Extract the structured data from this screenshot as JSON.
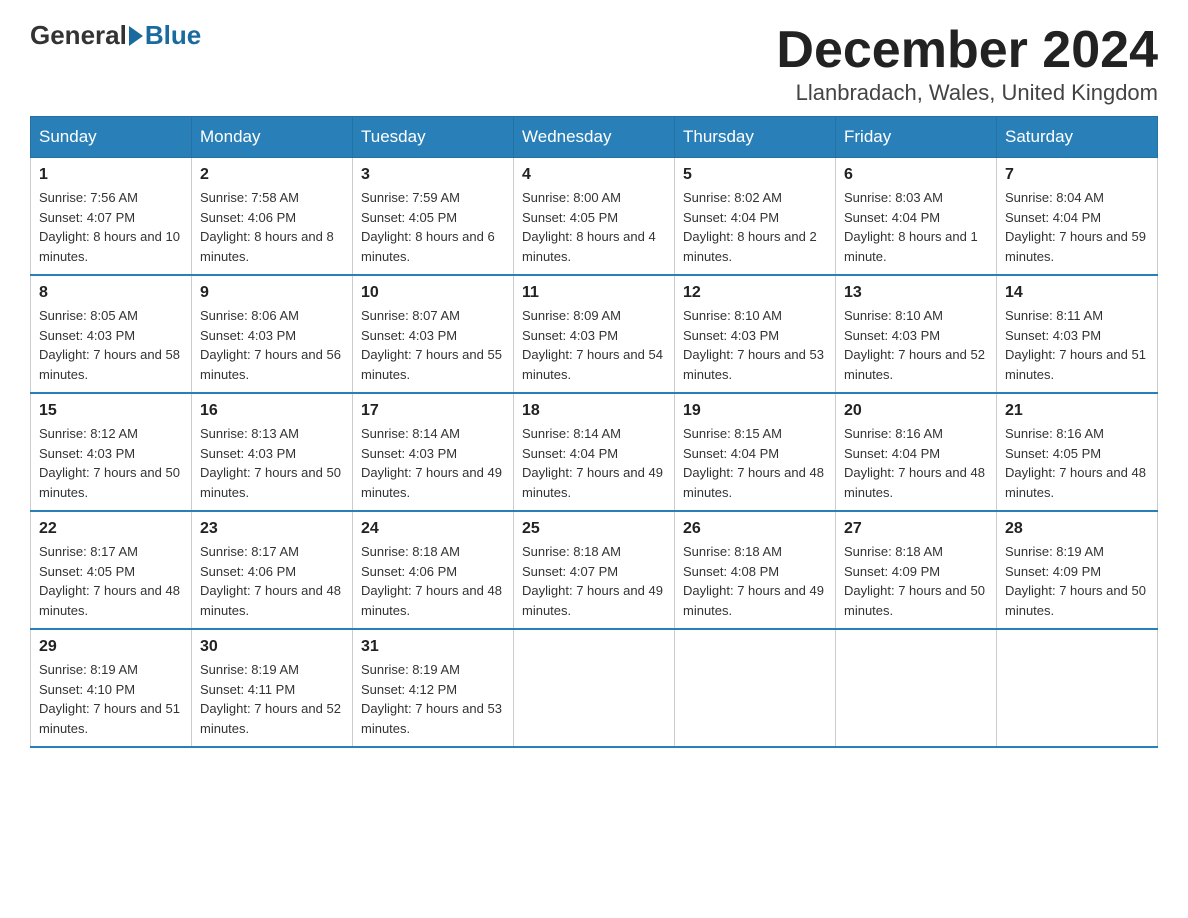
{
  "header": {
    "logo_general": "General",
    "logo_blue": "Blue",
    "month_title": "December 2024",
    "location": "Llanbradach, Wales, United Kingdom"
  },
  "weekdays": [
    "Sunday",
    "Monday",
    "Tuesday",
    "Wednesday",
    "Thursday",
    "Friday",
    "Saturday"
  ],
  "weeks": [
    [
      {
        "day": "1",
        "sunrise": "7:56 AM",
        "sunset": "4:07 PM",
        "daylight": "8 hours and 10 minutes."
      },
      {
        "day": "2",
        "sunrise": "7:58 AM",
        "sunset": "4:06 PM",
        "daylight": "8 hours and 8 minutes."
      },
      {
        "day": "3",
        "sunrise": "7:59 AM",
        "sunset": "4:05 PM",
        "daylight": "8 hours and 6 minutes."
      },
      {
        "day": "4",
        "sunrise": "8:00 AM",
        "sunset": "4:05 PM",
        "daylight": "8 hours and 4 minutes."
      },
      {
        "day": "5",
        "sunrise": "8:02 AM",
        "sunset": "4:04 PM",
        "daylight": "8 hours and 2 minutes."
      },
      {
        "day": "6",
        "sunrise": "8:03 AM",
        "sunset": "4:04 PM",
        "daylight": "8 hours and 1 minute."
      },
      {
        "day": "7",
        "sunrise": "8:04 AM",
        "sunset": "4:04 PM",
        "daylight": "7 hours and 59 minutes."
      }
    ],
    [
      {
        "day": "8",
        "sunrise": "8:05 AM",
        "sunset": "4:03 PM",
        "daylight": "7 hours and 58 minutes."
      },
      {
        "day": "9",
        "sunrise": "8:06 AM",
        "sunset": "4:03 PM",
        "daylight": "7 hours and 56 minutes."
      },
      {
        "day": "10",
        "sunrise": "8:07 AM",
        "sunset": "4:03 PM",
        "daylight": "7 hours and 55 minutes."
      },
      {
        "day": "11",
        "sunrise": "8:09 AM",
        "sunset": "4:03 PM",
        "daylight": "7 hours and 54 minutes."
      },
      {
        "day": "12",
        "sunrise": "8:10 AM",
        "sunset": "4:03 PM",
        "daylight": "7 hours and 53 minutes."
      },
      {
        "day": "13",
        "sunrise": "8:10 AM",
        "sunset": "4:03 PM",
        "daylight": "7 hours and 52 minutes."
      },
      {
        "day": "14",
        "sunrise": "8:11 AM",
        "sunset": "4:03 PM",
        "daylight": "7 hours and 51 minutes."
      }
    ],
    [
      {
        "day": "15",
        "sunrise": "8:12 AM",
        "sunset": "4:03 PM",
        "daylight": "7 hours and 50 minutes."
      },
      {
        "day": "16",
        "sunrise": "8:13 AM",
        "sunset": "4:03 PM",
        "daylight": "7 hours and 50 minutes."
      },
      {
        "day": "17",
        "sunrise": "8:14 AM",
        "sunset": "4:03 PM",
        "daylight": "7 hours and 49 minutes."
      },
      {
        "day": "18",
        "sunrise": "8:14 AM",
        "sunset": "4:04 PM",
        "daylight": "7 hours and 49 minutes."
      },
      {
        "day": "19",
        "sunrise": "8:15 AM",
        "sunset": "4:04 PM",
        "daylight": "7 hours and 48 minutes."
      },
      {
        "day": "20",
        "sunrise": "8:16 AM",
        "sunset": "4:04 PM",
        "daylight": "7 hours and 48 minutes."
      },
      {
        "day": "21",
        "sunrise": "8:16 AM",
        "sunset": "4:05 PM",
        "daylight": "7 hours and 48 minutes."
      }
    ],
    [
      {
        "day": "22",
        "sunrise": "8:17 AM",
        "sunset": "4:05 PM",
        "daylight": "7 hours and 48 minutes."
      },
      {
        "day": "23",
        "sunrise": "8:17 AM",
        "sunset": "4:06 PM",
        "daylight": "7 hours and 48 minutes."
      },
      {
        "day": "24",
        "sunrise": "8:18 AM",
        "sunset": "4:06 PM",
        "daylight": "7 hours and 48 minutes."
      },
      {
        "day": "25",
        "sunrise": "8:18 AM",
        "sunset": "4:07 PM",
        "daylight": "7 hours and 49 minutes."
      },
      {
        "day": "26",
        "sunrise": "8:18 AM",
        "sunset": "4:08 PM",
        "daylight": "7 hours and 49 minutes."
      },
      {
        "day": "27",
        "sunrise": "8:18 AM",
        "sunset": "4:09 PM",
        "daylight": "7 hours and 50 minutes."
      },
      {
        "day": "28",
        "sunrise": "8:19 AM",
        "sunset": "4:09 PM",
        "daylight": "7 hours and 50 minutes."
      }
    ],
    [
      {
        "day": "29",
        "sunrise": "8:19 AM",
        "sunset": "4:10 PM",
        "daylight": "7 hours and 51 minutes."
      },
      {
        "day": "30",
        "sunrise": "8:19 AM",
        "sunset": "4:11 PM",
        "daylight": "7 hours and 52 minutes."
      },
      {
        "day": "31",
        "sunrise": "8:19 AM",
        "sunset": "4:12 PM",
        "daylight": "7 hours and 53 minutes."
      },
      null,
      null,
      null,
      null
    ]
  ],
  "labels": {
    "sunrise": "Sunrise:",
    "sunset": "Sunset:",
    "daylight": "Daylight:"
  }
}
